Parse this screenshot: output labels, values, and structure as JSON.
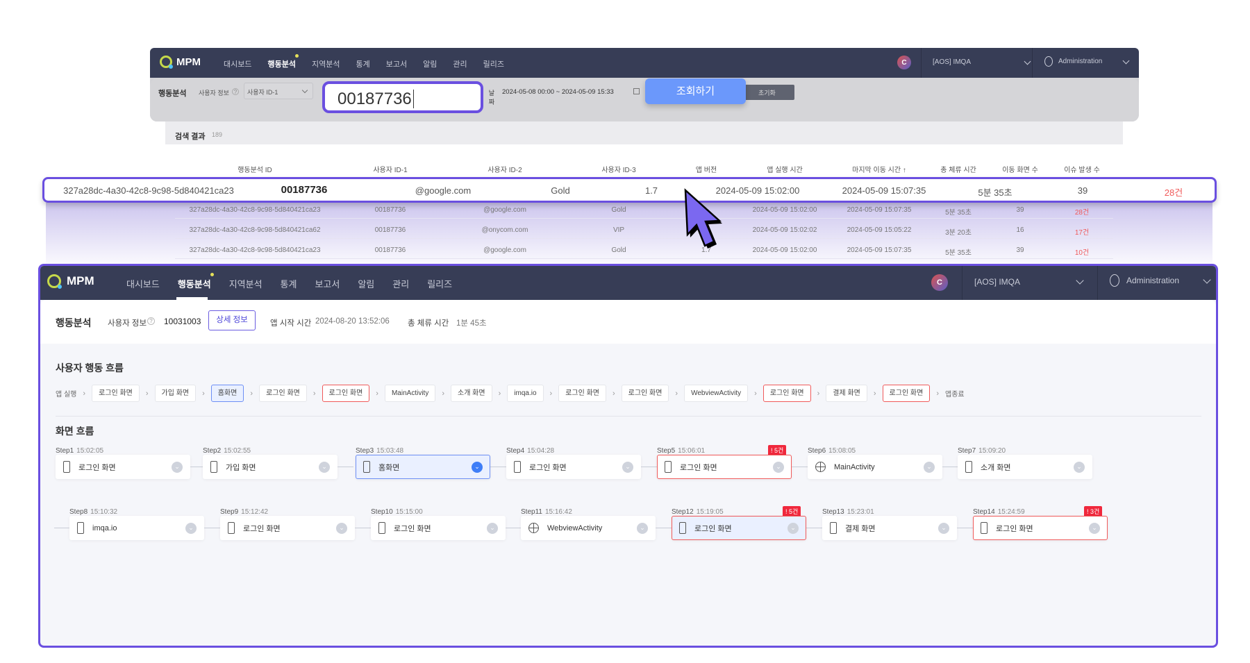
{
  "top": {
    "brand": "MPM",
    "menu": [
      "대시보드",
      "행동분석",
      "지역분석",
      "통계",
      "보고서",
      "알림",
      "관리",
      "릴리즈"
    ],
    "active_menu": "행동분석",
    "avatar": "C",
    "project": "[AOS] IMQA",
    "user": "Administration",
    "search": {
      "title": "행동분석",
      "user_info_label": "사용자 정보",
      "id_select": "사용자 ID-1",
      "id_value": "00187736",
      "date_label": "날짜",
      "date_range": "2024-05-08 00:00 ~ 2024-05-09 15:33",
      "search_button": "조회하기",
      "reset_button": "초기화"
    },
    "results": {
      "title": "검색 결과",
      "count": "189",
      "columns": [
        "행동분석 ID",
        "사용자 ID-1",
        "사용자 ID-2",
        "사용자 ID-3",
        "앱 버전",
        "앱 실행 시간",
        "마지막 이동 시간 ↑",
        "총 체류 시간",
        "이동 화면 수",
        "이슈 발생 수"
      ],
      "highlighted_row": [
        "327a28dc-4a30-42c8-9c98-5d840421ca23",
        "00187736",
        "@google.com",
        "Gold",
        "1.7",
        "2024-05-09 15:02:00",
        "2024-05-09 15:07:35",
        "5분 35초",
        "39",
        "28건"
      ],
      "rows": [
        [
          "327a28dc-4a30-42c8-9c98-5d840421ca23",
          "00187736",
          "@google.com",
          "Gold",
          "",
          "2024-05-09 15:02:00",
          "2024-05-09 15:07:35",
          "5분 35초",
          "39",
          "28건"
        ],
        [
          "327a28dc-4a30-42c8-9c98-5d840421ca62",
          "00187736",
          "@onycom.com",
          "VIP",
          "",
          "2024-05-09 15:02:02",
          "2024-05-09 15:05:22",
          "3분 20초",
          "16",
          "17건"
        ],
        [
          "327a28dc-4a30-42c8-9c98-5d840421ca23",
          "00187736",
          "@google.com",
          "Gold",
          "1.7",
          "2024-05-09 15:02:00",
          "2024-05-09 15:07:35",
          "5분 35초",
          "39",
          "10건"
        ]
      ]
    }
  },
  "bottom": {
    "brand": "MPM",
    "menu": [
      "대시보드",
      "행동분석",
      "지역분석",
      "통계",
      "보고서",
      "알림",
      "관리",
      "릴리즈"
    ],
    "active_menu": "행동분석",
    "avatar": "C",
    "project": "[AOS] IMQA",
    "user": "Administration",
    "info": {
      "title": "행동분석",
      "user_info_label": "사용자 정보",
      "user_id": "10031003",
      "detail_button": "상세 정보",
      "start_label": "앱 시작 시간",
      "start_value": "2024-08-20 13:52:06",
      "stay_label": "총 체류 시간",
      "stay_value": "1분 45초"
    },
    "flow_title": "사용자 행동 흐름",
    "flow_start": "앱 실행",
    "flow_end": "앱종료",
    "flow": [
      {
        "label": "로그인 화면",
        "state": ""
      },
      {
        "label": "가입 화면",
        "state": ""
      },
      {
        "label": "홈화면",
        "state": "selected"
      },
      {
        "label": "로그인 화면",
        "state": ""
      },
      {
        "label": "로그인 화면",
        "state": "error"
      },
      {
        "label": "MainActivity",
        "state": ""
      },
      {
        "label": "소개 화면",
        "state": ""
      },
      {
        "label": "imqa.io",
        "state": ""
      },
      {
        "label": "로그인 화면",
        "state": ""
      },
      {
        "label": "로그인 화면",
        "state": ""
      },
      {
        "label": "WebviewActivity",
        "state": ""
      },
      {
        "label": "로그인 화면",
        "state": "error"
      },
      {
        "label": "결제 화면",
        "state": ""
      },
      {
        "label": "로그인 화면",
        "state": "error"
      }
    ],
    "screen_title": "화면 흐름",
    "steps": [
      {
        "step": "Step1",
        "time": "15:02:05",
        "label": "로그인 화면",
        "icon": "phone",
        "selected": false,
        "issues": ""
      },
      {
        "step": "Step2",
        "time": "15:02:55",
        "label": "가입 화면",
        "icon": "phone",
        "selected": false,
        "issues": ""
      },
      {
        "step": "Step3",
        "time": "15:03:48",
        "label": "홈화면",
        "icon": "phone",
        "selected": true,
        "issues": ""
      },
      {
        "step": "Step4",
        "time": "15:04:28",
        "label": "로그인 화면",
        "icon": "phone",
        "selected": false,
        "issues": ""
      },
      {
        "step": "Step5",
        "time": "15:06:01",
        "label": "로그인 화면",
        "icon": "phone",
        "selected": false,
        "issues": "! 5건"
      },
      {
        "step": "Step6",
        "time": "15:08:05",
        "label": "MainActivity",
        "icon": "globe",
        "selected": false,
        "issues": ""
      },
      {
        "step": "Step7",
        "time": "15:09:20",
        "label": "소개 화면",
        "icon": "phone",
        "selected": false,
        "issues": ""
      },
      {
        "step": "Step8",
        "time": "15:10:32",
        "label": "imqa.io",
        "icon": "phone",
        "selected": false,
        "issues": ""
      },
      {
        "step": "Step9",
        "time": "15:12:42",
        "label": "로그인 화면",
        "icon": "phone",
        "selected": false,
        "issues": ""
      },
      {
        "step": "Step10",
        "time": "15:15:00",
        "label": "로그인 화면",
        "icon": "phone",
        "selected": false,
        "issues": ""
      },
      {
        "step": "Step11",
        "time": "15:16:42",
        "label": "WebviewActivity",
        "icon": "globe",
        "selected": false,
        "issues": ""
      },
      {
        "step": "Step12",
        "time": "15:19:05",
        "label": "로그인 화면",
        "icon": "phone",
        "selected": true,
        "issues": "! 5건"
      },
      {
        "step": "Step13",
        "time": "15:23:01",
        "label": "결제 화면",
        "icon": "phone",
        "selected": false,
        "issues": ""
      },
      {
        "step": "Step14",
        "time": "15:24:59",
        "label": "로그인 화면",
        "icon": "phone",
        "selected": false,
        "issues": "! 3건"
      }
    ],
    "colors": {
      "accent": "#6a4fe0",
      "error": "#f05a5a",
      "selected": "#6d8ff5",
      "nav": "#373d56"
    }
  }
}
